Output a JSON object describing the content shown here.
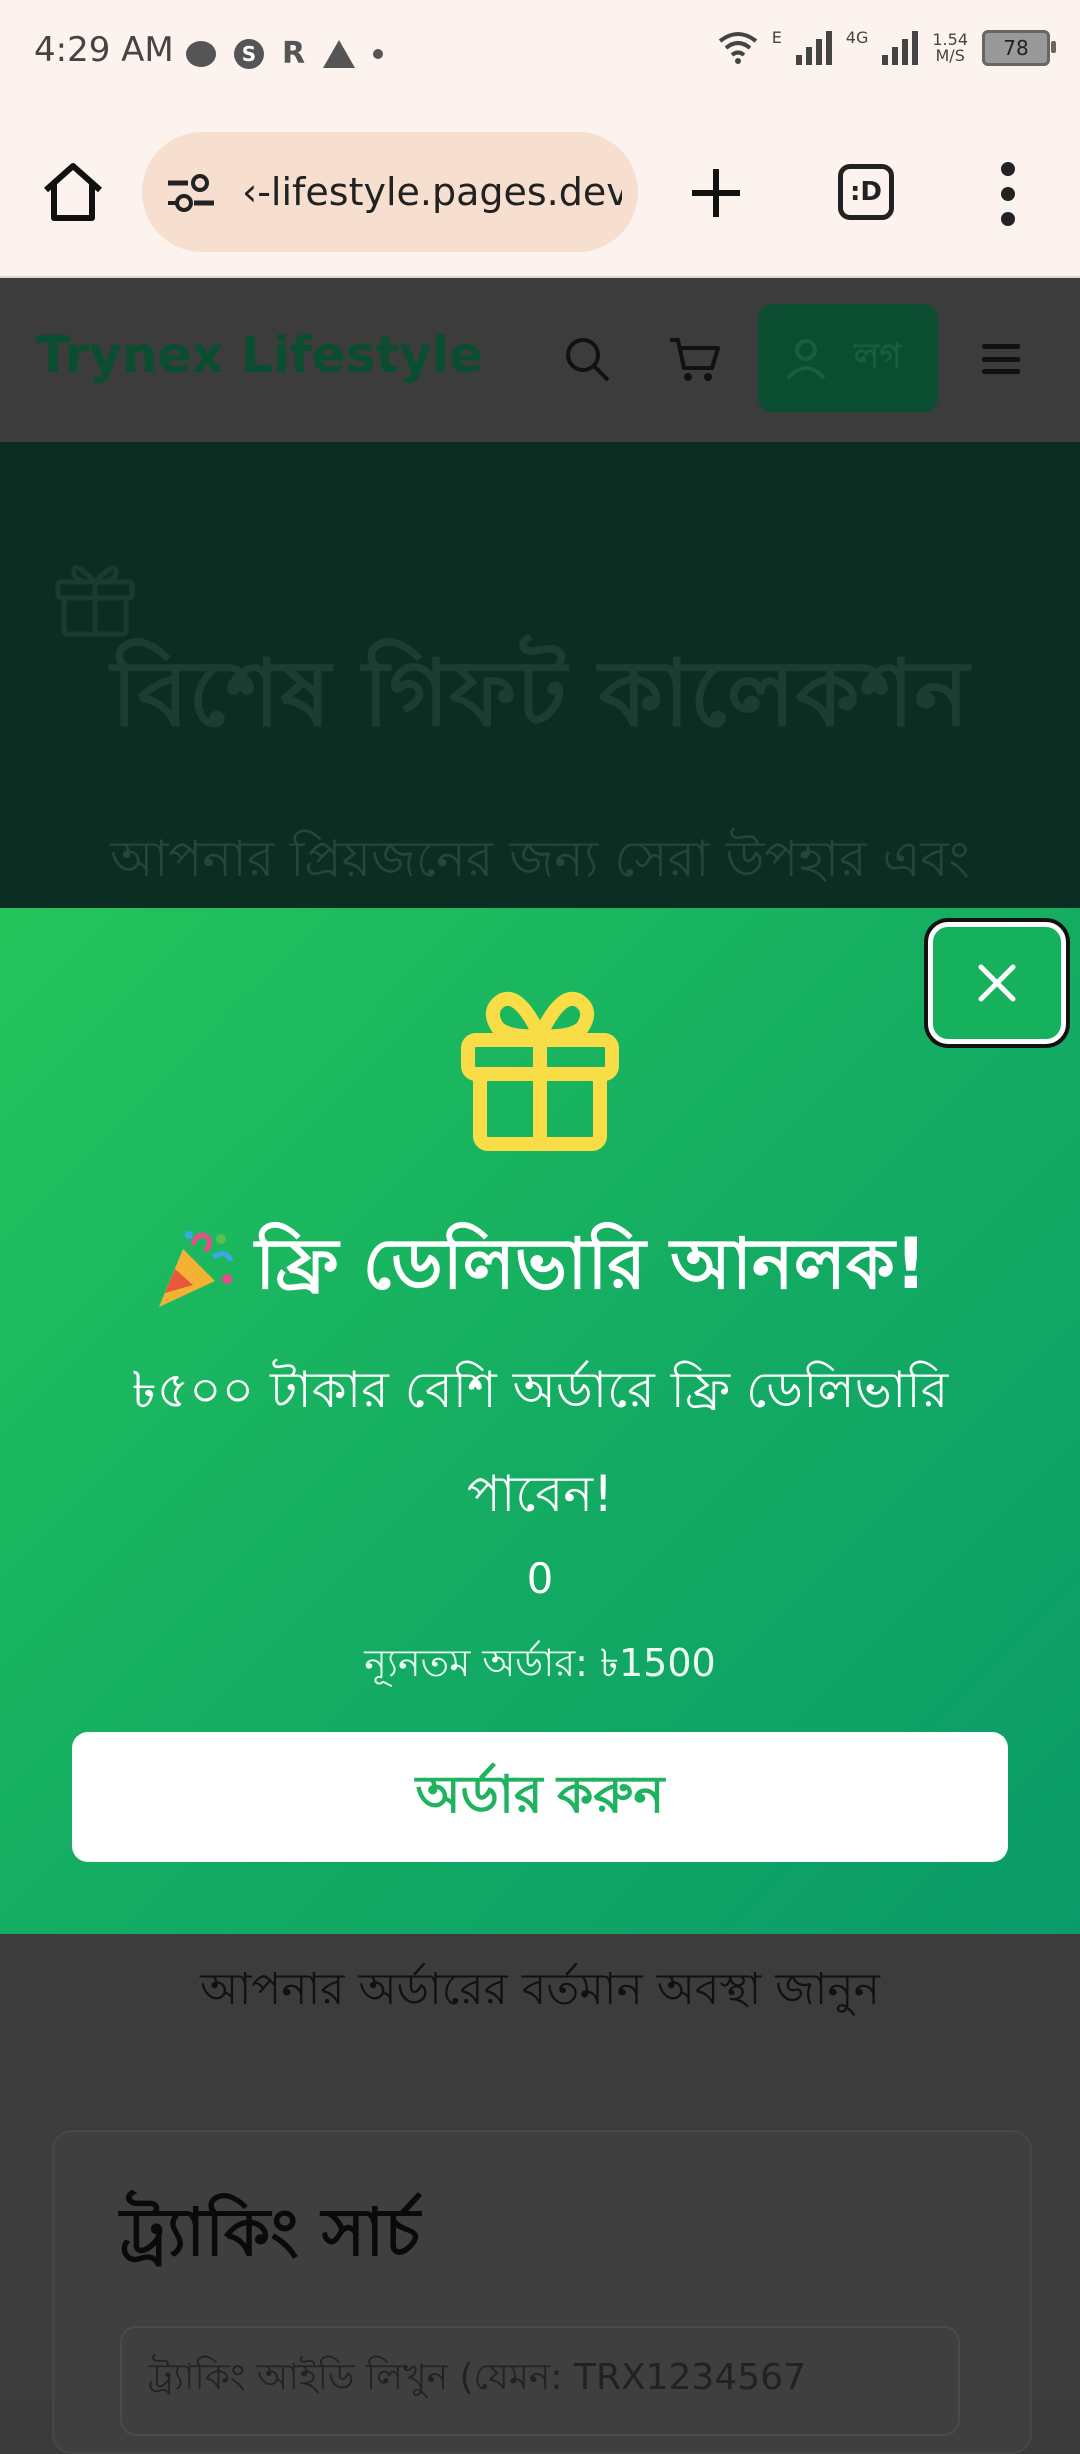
{
  "status_bar": {
    "time": "4:29 AM",
    "net_speed": "1.54",
    "net_unit": "M/S",
    "battery": "78",
    "e_label": "E",
    "fourg_label": "4G"
  },
  "browser": {
    "url": "‹-lifestyle.pages.dev",
    "tabs_label": ":D"
  },
  "site_header": {
    "brand": "Trynex Lifestyle",
    "login_label": "লগ"
  },
  "hero": {
    "title": "বিশেষ গিফট কালেকশন",
    "subtitle": "আপনার প্রিয়জনের জন্য সেরা উপহার এবং"
  },
  "modal": {
    "title": "ফ্রি ডেলিভারি আনলক!",
    "description": "৳৫০০ টাকার বেশি অর্ডারে ফ্রি ডেলিভারি পাবেন!",
    "counter": "0",
    "min_order": "ন্যূনতম অর্ডার: ৳1500",
    "order_button": "অর্ডার করুন",
    "accent_color": "#1fb35f",
    "gift_color": "#f9dd47"
  },
  "lower": {
    "subtitle": "আপনার অর্ডারের বর্তমান অবস্থা জানুন",
    "tracking_title": "ট্র্যাকিং সার্চ",
    "tracking_placeholder": "ট্র্যাকিং আইডি লিখুন (যেমন: TRX1234567"
  },
  "icons": [
    "home-icon",
    "site-settings-icon",
    "plus-icon",
    "more-icon",
    "search-icon",
    "cart-icon",
    "user-icon",
    "menu-icon",
    "gift-icon",
    "close-icon",
    "party-popper-icon"
  ]
}
